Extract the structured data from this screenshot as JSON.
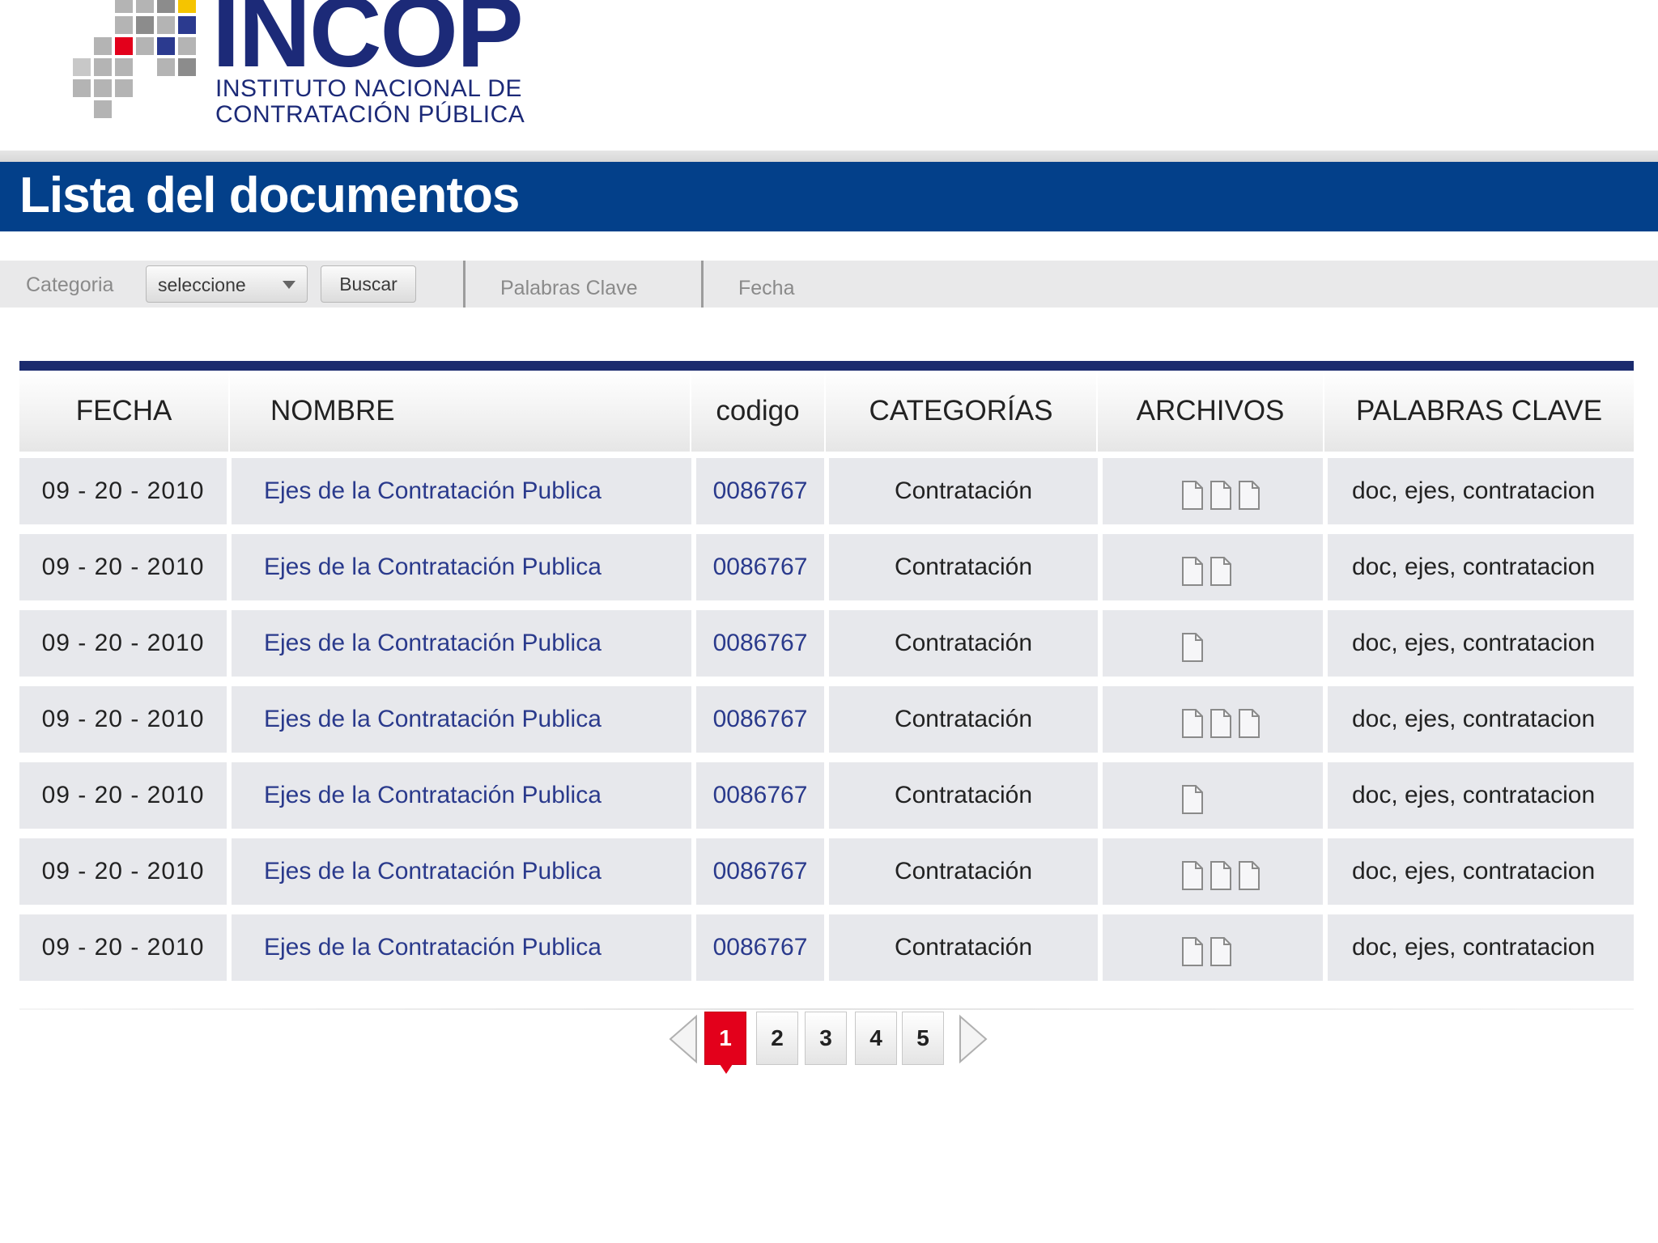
{
  "brand": {
    "name": "INCOP",
    "subtitle_line1": "INSTITUTO NACIONAL DE",
    "subtitle_line2": "CONTRATACIÓN PÚBLICA"
  },
  "header": {
    "title": "Lista del documentos"
  },
  "filters": {
    "category_label": "Categoria",
    "category_select": "seleccione",
    "search_button": "Buscar",
    "keywords_tab": "Palabras Clave",
    "date_tab": "Fecha"
  },
  "table": {
    "columns": [
      "FECHA",
      "NOMBRE",
      "codigo",
      "CATEGORÍAS",
      "ARCHIVOS",
      "PALABRAS CLAVE"
    ],
    "rows": [
      {
        "fecha": "09 - 20 -  2010",
        "nombre": "Ejes de la Contratación Publica",
        "codigo": "0086767",
        "categoria": "Contratación",
        "archivos": 3,
        "palabras": "doc, ejes, contratacion"
      },
      {
        "fecha": "09 - 20 -  2010",
        "nombre": "Ejes de la Contratación Publica",
        "codigo": "0086767",
        "categoria": "Contratación",
        "archivos": 2,
        "palabras": "doc, ejes, contratacion"
      },
      {
        "fecha": "09 - 20 -  2010",
        "nombre": "Ejes de la Contratación Publica",
        "codigo": "0086767",
        "categoria": "Contratación",
        "archivos": 1,
        "palabras": "doc, ejes, contratacion"
      },
      {
        "fecha": "09 - 20 -  2010",
        "nombre": "Ejes de la Contratación Publica",
        "codigo": "0086767",
        "categoria": "Contratación",
        "archivos": 3,
        "palabras": "doc, ejes, contratacion"
      },
      {
        "fecha": "09 - 20 -  2010",
        "nombre": "Ejes de la Contratación Publica",
        "codigo": "0086767",
        "categoria": "Contratación",
        "archivos": 1,
        "palabras": "doc, ejes, contratacion"
      },
      {
        "fecha": "09 - 20 -  2010",
        "nombre": "Ejes de la Contratación Publica",
        "codigo": "0086767",
        "categoria": "Contratación",
        "archivos": 3,
        "palabras": "doc, ejes, contratacion"
      },
      {
        "fecha": "09 - 20 -  2010",
        "nombre": "Ejes de la Contratación Publica",
        "codigo": "0086767",
        "categoria": "Contratación",
        "archivos": 2,
        "palabras": "doc, ejes, contratacion"
      }
    ]
  },
  "pagination": {
    "pages": [
      "1",
      "2",
      "3",
      "4",
      "5"
    ],
    "current": "1"
  },
  "colors": {
    "brand_blue": "#03408a",
    "logo_navy": "#1c2a78",
    "table_accent": "#1b2b6e",
    "link": "#2a3a8c",
    "active_page": "#e3001b"
  },
  "icons": {
    "file": "document-icon",
    "prev": "arrow-left-icon",
    "next": "arrow-right-icon",
    "dropdown": "chevron-down-icon"
  }
}
